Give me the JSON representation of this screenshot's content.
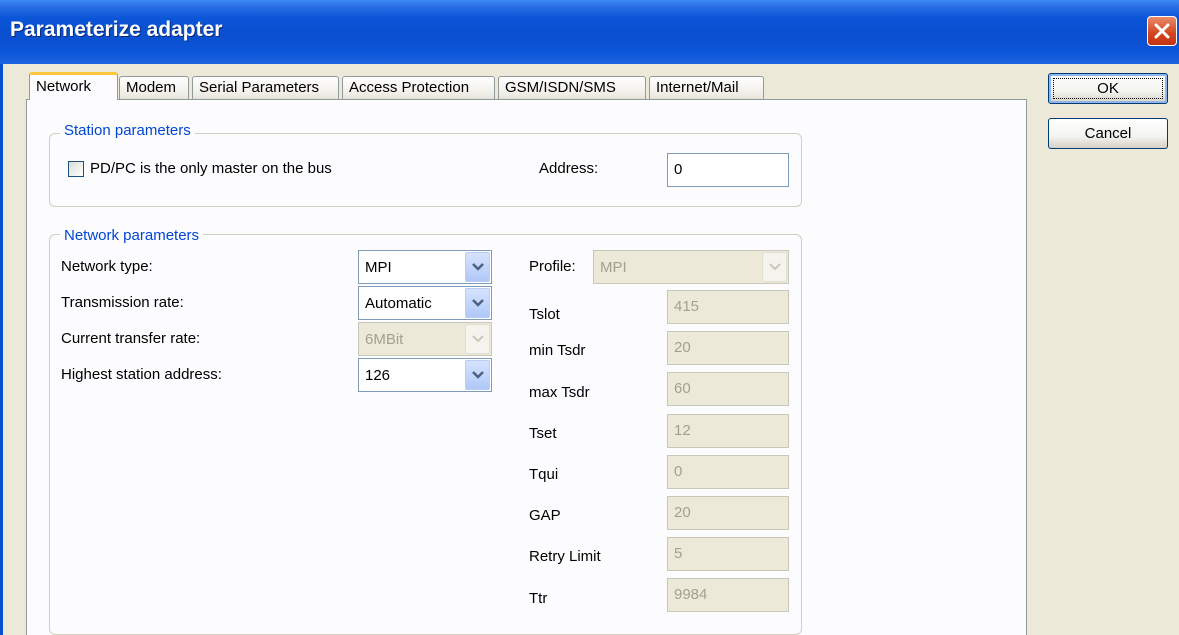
{
  "window": {
    "title": "Parameterize adapter"
  },
  "tabs": [
    {
      "label": "Network",
      "active": true
    },
    {
      "label": "Modem"
    },
    {
      "label": "Serial Parameters"
    },
    {
      "label": "Access Protection"
    },
    {
      "label": "GSM/ISDN/SMS"
    },
    {
      "label": "Internet/Mail"
    }
  ],
  "buttons": {
    "ok": "OK",
    "cancel": "Cancel"
  },
  "station": {
    "group_label": "Station parameters",
    "only_master_label": "PD/PC is the only master on the bus",
    "only_master_checked": false,
    "address_label": "Address:",
    "address_value": "0"
  },
  "network": {
    "group_label": "Network parameters",
    "network_type_label": "Network type:",
    "network_type_value": "MPI",
    "transmission_rate_label": "Transmission rate:",
    "transmission_rate_value": "Automatic",
    "current_rate_label": "Current transfer rate:",
    "current_rate_value": "6MBit",
    "highest_address_label": "Highest station address:",
    "highest_address_value": "126",
    "profile_label": "Profile:",
    "profile_value": "MPI",
    "params": [
      {
        "label": "Tslot",
        "value": "415"
      },
      {
        "label": "min Tsdr",
        "value": "20"
      },
      {
        "label": "max Tsdr",
        "value": "60"
      },
      {
        "label": "Tset",
        "value": "12"
      },
      {
        "label": "Tqui",
        "value": "0"
      },
      {
        "label": "GAP",
        "value": "20"
      },
      {
        "label": "Retry Limit",
        "value": "5"
      },
      {
        "label": "Ttr",
        "value": "9984"
      }
    ]
  },
  "colors": {
    "title_bar": "#0b55d8",
    "group_label": "#0046d5",
    "active_tab_accent": "#ffc83c",
    "dialog_bg": "#ece9d8"
  }
}
